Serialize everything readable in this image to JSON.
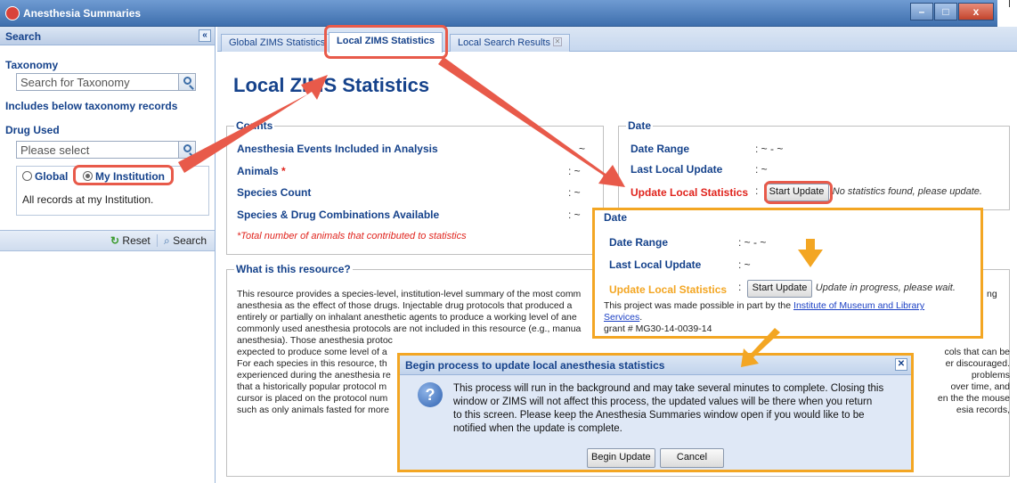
{
  "window": {
    "title": "Anesthesia Summaries",
    "buttons": [
      "–",
      "□",
      "x"
    ]
  },
  "left_panel": {
    "header": "Search",
    "collapse_glyph": "«",
    "taxonomy_label": "Taxonomy",
    "taxonomy_placeholder": "Search for Taxonomy",
    "includes_below": "Includes below taxonomy records",
    "drug_label": "Drug Used",
    "drug_placeholder": "Please select",
    "scope": {
      "global": "Global",
      "my_institution": "My Institution",
      "selected": "my_institution"
    },
    "scope_note": "All records at my Institution.",
    "reset_label": "Reset",
    "search_label": "Search"
  },
  "tabs": [
    {
      "label": "Global ZIMS Statistics",
      "active": false
    },
    {
      "label": "Local ZIMS Statistics",
      "active": true
    },
    {
      "label": "Local Search Results",
      "active": false,
      "closable": true
    }
  ],
  "main": {
    "title": "Local ZIMS Statistics",
    "counts": {
      "legend": "Counts",
      "rows": [
        {
          "label": "Anesthesia Events Included in Analysis",
          "value": "~"
        },
        {
          "label": "Animals",
          "required_mark": "*",
          "value": "~"
        },
        {
          "label": "Species Count",
          "value": "~"
        },
        {
          "label": "Species & Drug Combinations Available",
          "value": "~"
        }
      ],
      "footnote": "*Total number of animals that contributed to statistics"
    },
    "date": {
      "legend": "Date",
      "range_label": "Date Range",
      "range_value": "~ - ~",
      "last_update_label": "Last Local Update",
      "last_update_value": "~",
      "update_label": "Update Local Statistics",
      "start_button": "Start Update",
      "status": "No statistics found, please update."
    },
    "resource": {
      "legend": "What is this resource?",
      "lines_left": [
        "This resource provides a species-level, institution-level summary of the most comm",
        "anesthesia as the effect of those drugs. Injectable drug protocols that produced a",
        "entirely or partially on inhalant anesthetic agents to produce a working level of ane",
        "commonly used anesthesia protocols are not included in this resource (e.g., manua",
        "anesthesia). Those anesthesia protoc",
        "expected to produce some level of a",
        "For each species in this resource, th",
        "experienced during the anesthesia re",
        "that a historically popular protocol m",
        "cursor is placed on the protocol num",
        "such as only animals fasted for more"
      ],
      "lines_right": [
        "ng",
        "cols that can be",
        "er discouraged.",
        "problems",
        "over time, and",
        "en the the mouse",
        "esia records,"
      ]
    }
  },
  "callout": {
    "legend": "Date",
    "range_label": "Date Range",
    "range_value": "~ - ~",
    "last_update_label": "Last Local Update",
    "last_update_value": "~",
    "update_label": "Update Local Statistics",
    "start_button": "Start Update",
    "status": "Update in progress, please wait.",
    "credit_prefix": "This project was made possible in part by the",
    "credit_link": "Institute of Museum and Library Services",
    "grant": "grant # MG30-14-0039-14"
  },
  "dialog": {
    "title": "Begin process to update local anesthesia statistics",
    "message_lines": [
      "This process will run in the background and may take several minutes to complete. Closing this",
      "window or ZIMS will not affect this process, the updated values will be there when you return",
      "to this screen. Please keep the Anesthesia Summaries window open if you would like to be",
      "notified when the update is complete."
    ],
    "ok_button": "Begin Update",
    "cancel_button": "Cancel"
  },
  "colors": {
    "annotation_red": "#e85a4a",
    "annotation_orange": "#f3a623",
    "heading_blue": "#15428b",
    "warning_red": "#e0241d"
  }
}
